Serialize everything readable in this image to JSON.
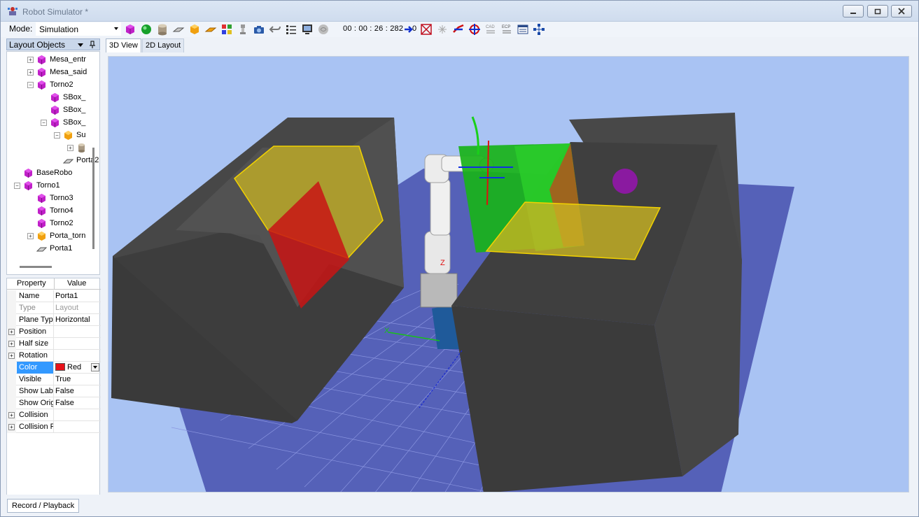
{
  "window": {
    "title": "Robot Simulator *",
    "accent_color": "#cfdcee"
  },
  "toolbar": {
    "mode_label": "Mode:",
    "mode_value": "Simulation",
    "timer": "00 : 00 : 26 : 282",
    "icons": [
      "add-box-icon",
      "add-sphere-icon",
      "add-cylinder-icon",
      "add-plane-icon",
      "add-orange-box-icon",
      "add-surface-icon",
      "add-parts-icon",
      "tool-icon",
      "camera-icon",
      "undo-icon",
      "list-icon",
      "monitor-icon",
      "brain-icon",
      "goto-zero-icon",
      "cross-box-icon",
      "sparkle-icon",
      "link-icon",
      "move-icon",
      "cad-icon",
      "ecp-icon",
      "table-icon",
      "network-icon"
    ],
    "goto_zero_label": "0"
  },
  "left_panel": {
    "header": "Layout Objects",
    "tree": [
      {
        "label": "Mesa_entr",
        "icon": "magenta-box-icon",
        "expander": "+",
        "level": 2
      },
      {
        "label": "Mesa_said",
        "icon": "magenta-box-icon",
        "expander": "+",
        "level": 2
      },
      {
        "label": "Torno2",
        "icon": "magenta-box-icon",
        "expander": "-",
        "level": 2
      },
      {
        "label": "SBox_",
        "icon": "magenta-box-icon",
        "expander": "",
        "level": 3
      },
      {
        "label": "SBox_",
        "icon": "magenta-box-icon",
        "expander": "",
        "level": 3
      },
      {
        "label": "SBox_",
        "icon": "magenta-box-icon",
        "expander": "-",
        "level": 3
      },
      {
        "label": "Su",
        "icon": "orange-box-icon",
        "expander": "-",
        "level": 4
      },
      {
        "label": "",
        "icon": "cylinder-icon",
        "expander": "+",
        "level": 5
      },
      {
        "label": "Porta2",
        "icon": "plane-icon",
        "expander": "",
        "level": 4
      },
      {
        "label": "BaseRobo",
        "icon": "magenta-box-icon",
        "expander": "",
        "level": 1
      },
      {
        "label": "Torno1",
        "icon": "magenta-box-icon",
        "expander": "-",
        "level": 1
      },
      {
        "label": "Torno3",
        "icon": "magenta-box-icon",
        "expander": "",
        "level": 2
      },
      {
        "label": "Torno4",
        "icon": "magenta-box-icon",
        "expander": "",
        "level": 2
      },
      {
        "label": "Torno2",
        "icon": "magenta-box-icon",
        "expander": "",
        "level": 2
      },
      {
        "label": "Porta_torn",
        "icon": "orange-box-icon",
        "expander": "+",
        "level": 2
      },
      {
        "label": "Porta1",
        "icon": "plane-icon",
        "expander": "",
        "level": 2
      }
    ]
  },
  "property_grid": {
    "header_property": "Property",
    "header_value": "Value",
    "rows": [
      {
        "name": "Name",
        "value": "Porta1",
        "expander": "",
        "muted": false,
        "selected": false
      },
      {
        "name": "Type",
        "value": "Layout",
        "expander": "",
        "muted": true,
        "selected": false
      },
      {
        "name": "Plane Type",
        "value": "Horizontal",
        "expander": "",
        "muted": false,
        "selected": false
      },
      {
        "name": "Position",
        "value": "",
        "expander": "+",
        "muted": false,
        "selected": false
      },
      {
        "name": "Half size",
        "value": "",
        "expander": "+",
        "muted": false,
        "selected": false
      },
      {
        "name": "Rotation",
        "value": "",
        "expander": "+",
        "muted": false,
        "selected": false
      },
      {
        "name": "Color",
        "value": "Red",
        "expander": "",
        "muted": false,
        "selected": true,
        "swatch": "#e8121a"
      },
      {
        "name": "Visible",
        "value": "True",
        "expander": "",
        "muted": false,
        "selected": false
      },
      {
        "name": "Show Labels",
        "value": "False",
        "expander": "",
        "muted": false,
        "selected": false
      },
      {
        "name": "Show Origin",
        "value": "False",
        "expander": "",
        "muted": false,
        "selected": false
      },
      {
        "name": "Collision",
        "value": "",
        "expander": "+",
        "muted": false,
        "selected": false
      },
      {
        "name": "Collision Pa",
        "value": "",
        "expander": "+",
        "muted": false,
        "selected": false
      }
    ]
  },
  "tabs": {
    "view3d": "3D View",
    "view2d": "2D Layout"
  },
  "scene": {
    "background_color": "#a9c3f3",
    "floor_color": "#5561b8",
    "box_color": "#4a4a4a",
    "axis_label_z": "Z",
    "axis_label_x": "X"
  },
  "bottom": {
    "record_tab": "Record / Playback"
  }
}
